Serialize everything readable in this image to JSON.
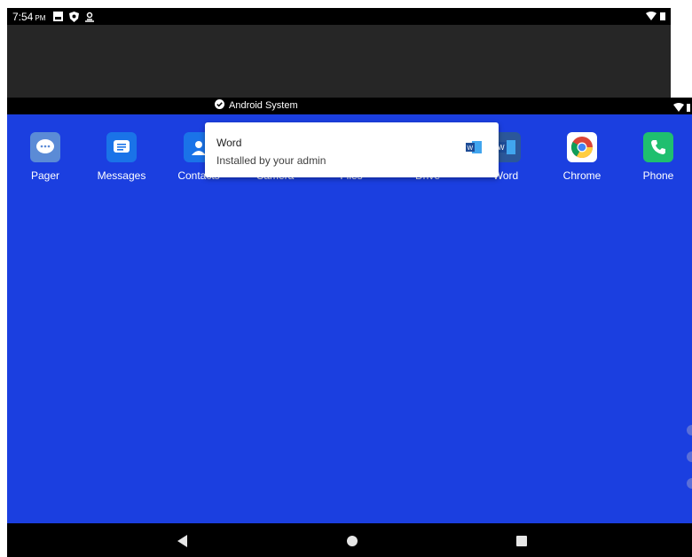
{
  "status_bar": {
    "time": "7:54",
    "ampm": "PM"
  },
  "system_notice": {
    "label": "Android System"
  },
  "notification": {
    "title": "Word",
    "text": "Installed by your admin"
  },
  "apps": [
    {
      "label": "Pager",
      "icon": "pager-icon",
      "color": "#5b8bd6"
    },
    {
      "label": "Messages",
      "icon": "messages-icon",
      "color": "#1a73e8"
    },
    {
      "label": "Contacts",
      "icon": "contacts-icon",
      "color": "#1a73e8"
    },
    {
      "label": "Camera",
      "icon": "camera-icon",
      "color": "#1b3fe0"
    },
    {
      "label": "Files",
      "icon": "files-icon",
      "color": "#1b3fe0"
    },
    {
      "label": "Drive",
      "icon": "drive-icon",
      "color": "#1b3fe0"
    },
    {
      "label": "Word",
      "icon": "word-icon",
      "color": "#2b579a"
    },
    {
      "label": "Chrome",
      "icon": "chrome-icon",
      "color": "#ffffff"
    },
    {
      "label": "Phone",
      "icon": "phone-icon",
      "color": "#1fbf6f"
    }
  ],
  "colors": {
    "home_background": "#1b3fe0",
    "status_bar": "#000000",
    "nav_bar": "#000000"
  }
}
